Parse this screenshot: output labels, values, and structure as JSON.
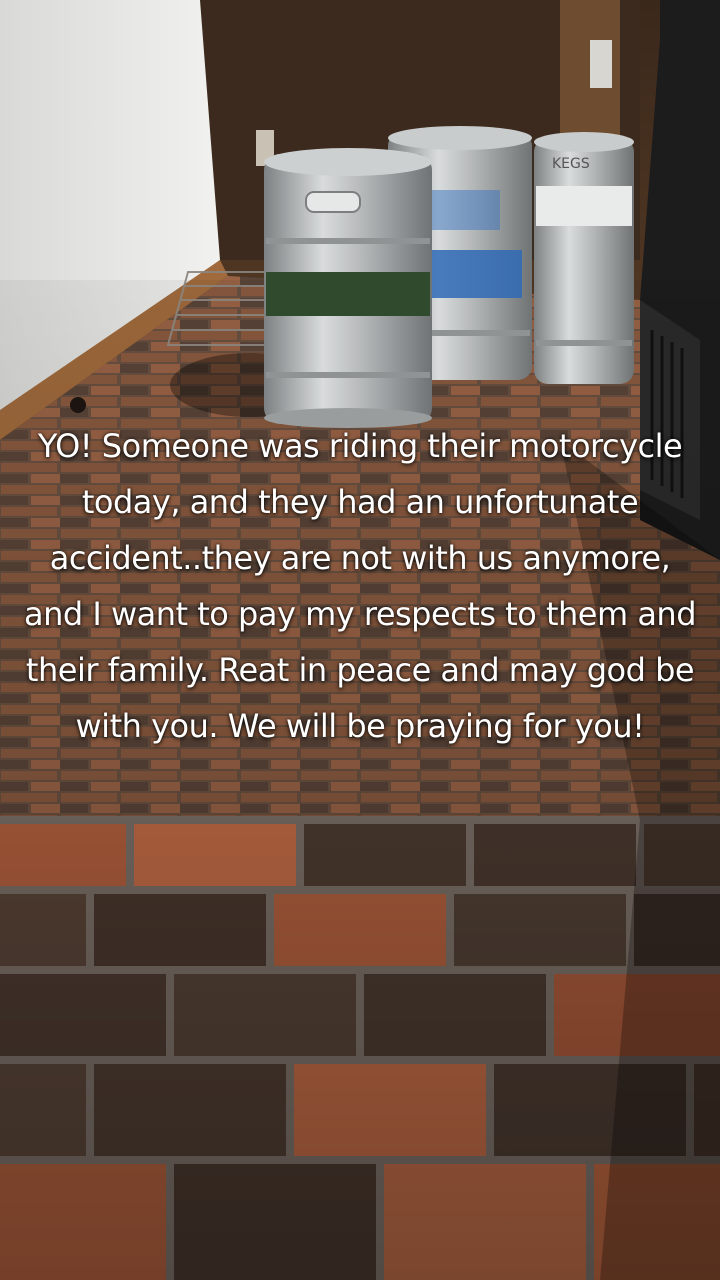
{
  "caption": {
    "text": "YO! Someone was riding their motorcycle today, and they had an unfortunate accident..they are not with us anymore, and I want to pay my respects to them and their family. Reat in peace and may god be with you. We will be praying for you!"
  },
  "kegs": [
    {
      "name": "keg-left",
      "label_color": "#2f4a2c"
    },
    {
      "name": "keg-middle",
      "label_color": "#2f6ab6"
    },
    {
      "name": "keg-right",
      "label_text": "KEGS"
    }
  ],
  "colors": {
    "wall": "#e6e6e3",
    "wood_trim": "#a06a3c",
    "brick_red": "#b4603e",
    "brick_dark": "#5a4438",
    "grout": "#7c7068",
    "steel": "#b9bcbd"
  }
}
